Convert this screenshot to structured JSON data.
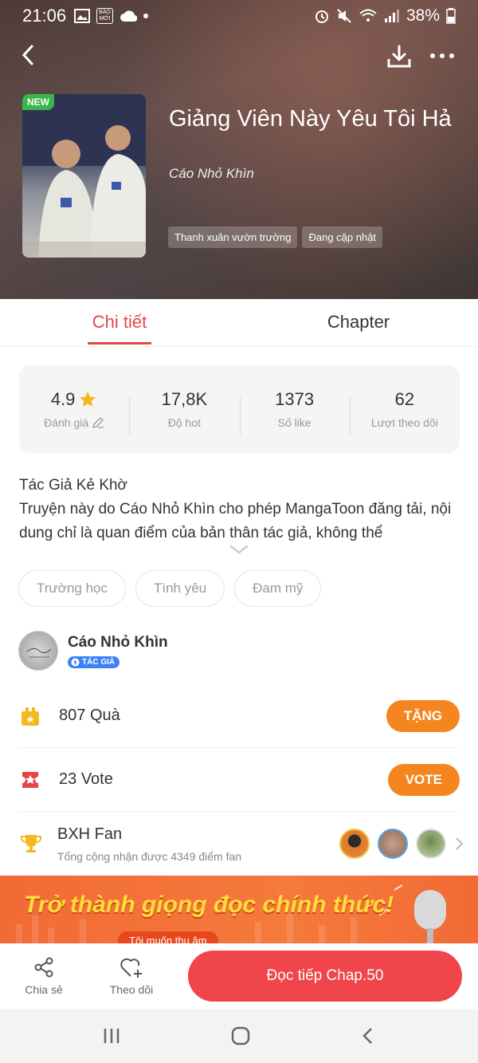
{
  "status_bar": {
    "time": "21:06",
    "battery": "38%",
    "news_badge_line1": "BÁO",
    "news_badge_line2": "MỚI"
  },
  "book": {
    "badge": "NEW",
    "title": "Giảng Viên Này Yêu Tôi Hả",
    "author": "Cáo Nhỏ Khìn",
    "genre_tags": [
      "Thanh xuân vườn trường",
      "Đang cập nhật"
    ]
  },
  "tabs": [
    {
      "label": "Chi tiết",
      "active": true
    },
    {
      "label": "Chapter",
      "active": false
    }
  ],
  "stats": [
    {
      "value": "4.9",
      "label": "Đánh giá"
    },
    {
      "value": "17,8K",
      "label": "Độ hot"
    },
    {
      "value": "1373",
      "label": "Số like"
    },
    {
      "value": "62",
      "label": "Lượt theo dõi"
    }
  ],
  "description": {
    "line1": "Tác Giả Kẻ Khờ",
    "line2": "Truyện này do Cáo Nhỏ Khìn cho phép MangaToon đăng tải, nội dung chỉ là quan điểm của bản thân tác giả, không thể"
  },
  "tags": [
    "Trường học",
    "Tình yêu",
    "Đam mỹ"
  ],
  "author_section": {
    "name": "Cáo Nhỏ Khìn",
    "badge": "TÁC GIẢ"
  },
  "gift_row": {
    "count": "807",
    "unit": "Quà",
    "button": "TẶNG"
  },
  "vote_row": {
    "count": "23",
    "unit": "Vote",
    "button": "VOTE"
  },
  "fan_row": {
    "title": "BXH Fan",
    "subtitle": "Tổng cộng nhận được 4349 điểm fan"
  },
  "banner": {
    "text": "Trở thành giọng đọc chính thức!",
    "button": "Tôi muốn thu âm"
  },
  "bottom_bar": {
    "share": "Chia sẻ",
    "follow": "Theo dõi",
    "read": "Đọc tiếp Chap.50"
  },
  "colors": {
    "accent": "#e64646",
    "orange": "#f5851f",
    "read_button": "#f0454a"
  }
}
